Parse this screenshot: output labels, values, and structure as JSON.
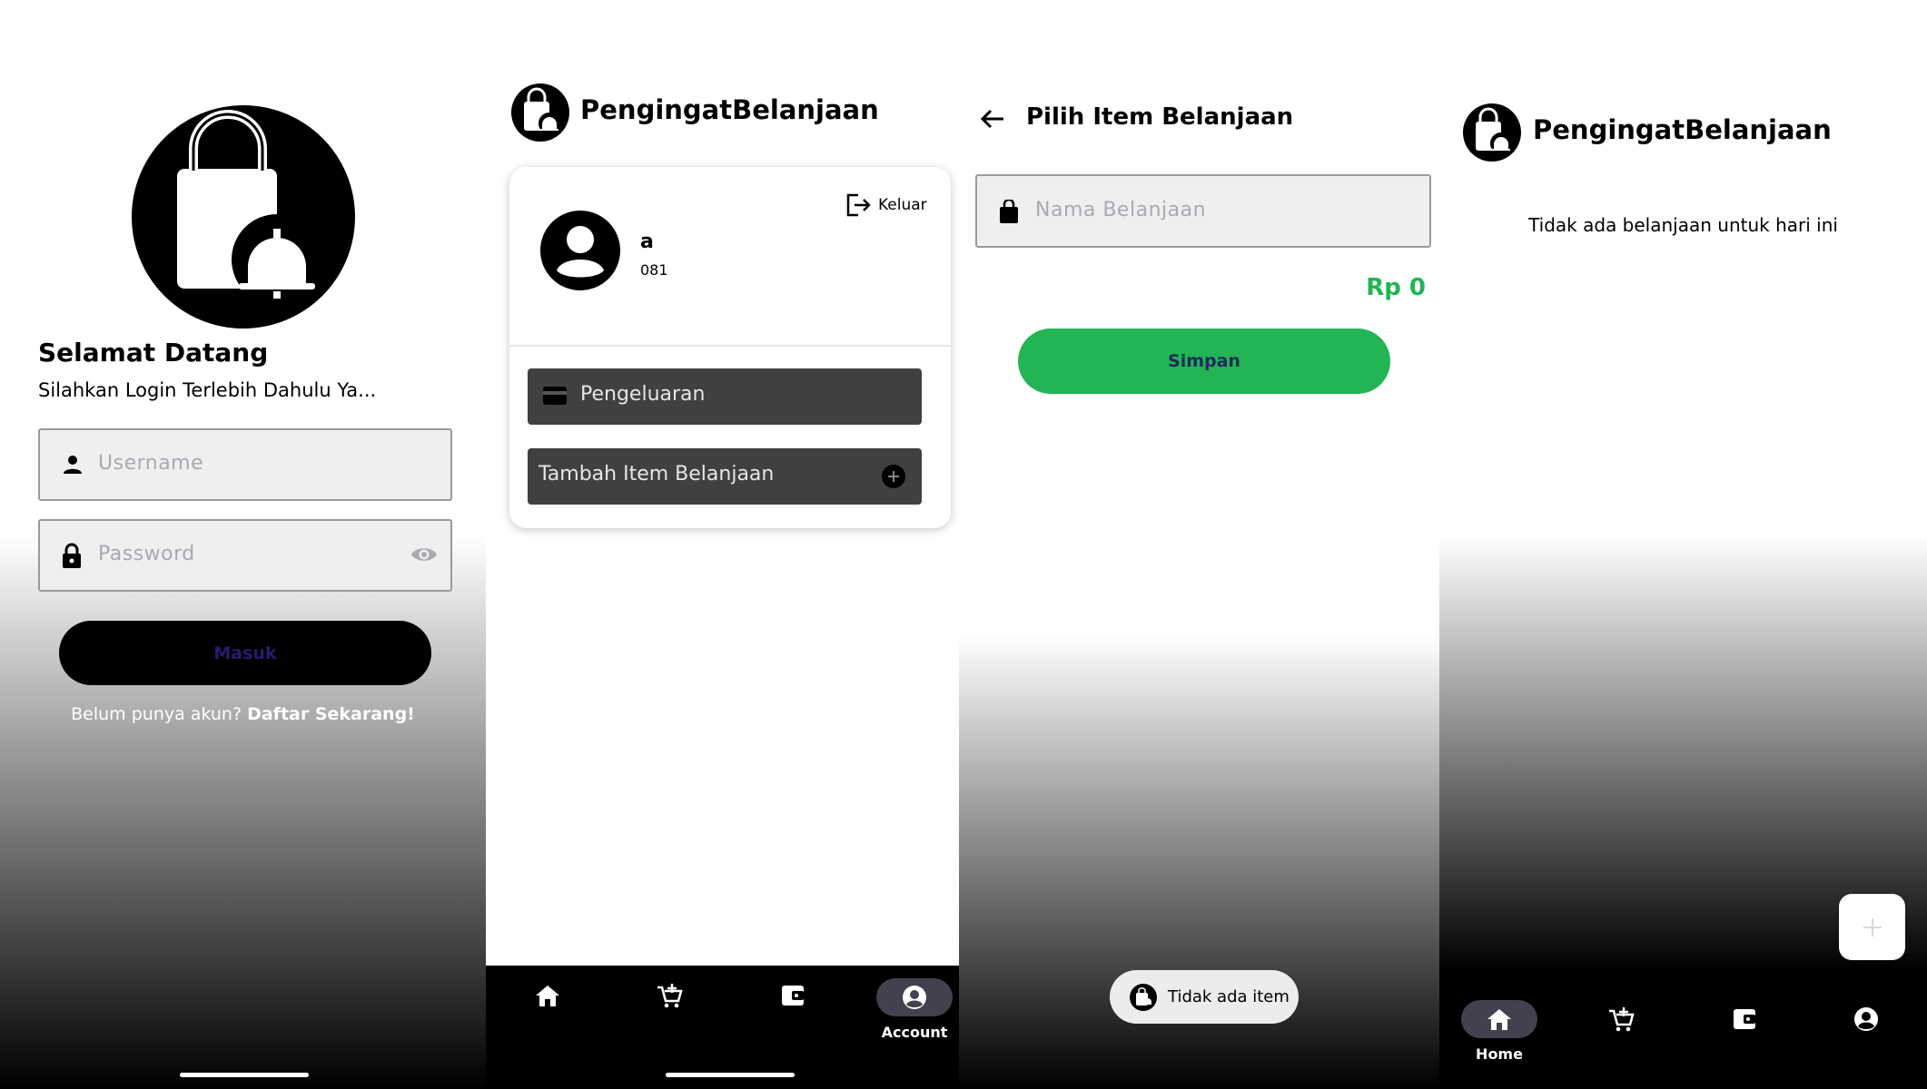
{
  "login": {
    "welcome_title": "Selamat Datang",
    "welcome_subtitle": "Silahkan Login Terlebih Dahulu Ya...",
    "username_placeholder": "Username",
    "password_placeholder": "Password",
    "login_button": "Masuk",
    "signup_prompt": "Belum punya akun?",
    "signup_link": "Daftar Sekarang!"
  },
  "account": {
    "app_title": "PengingatBelanjaan",
    "logout_label": "Keluar",
    "user_name": "a",
    "user_phone": "081",
    "menu": [
      {
        "label": "Pengeluaran",
        "icon": "wallet-card-icon"
      },
      {
        "label": "Tambah Item Belanjaan",
        "icon": "add-circle-icon"
      }
    ],
    "nav": {
      "active_label": "Account"
    }
  },
  "pick_items": {
    "title": "Pilih Item Belanjaan",
    "name_placeholder": "Nama Belanjaan",
    "total": "Rp 0",
    "save_button": "Simpan",
    "toast": "Tidak ada item"
  },
  "home": {
    "app_title": "PengingatBelanjaan",
    "empty_message": "Tidak ada belanjaan untuk hari ini",
    "nav": {
      "active_label": "Home"
    }
  },
  "colors": {
    "accent_green": "#22b455",
    "pill_active": "#44404f",
    "button_dark": "#404040",
    "login_button_text": "#2a1a6e",
    "save_button_text": "#1f2a5a"
  }
}
